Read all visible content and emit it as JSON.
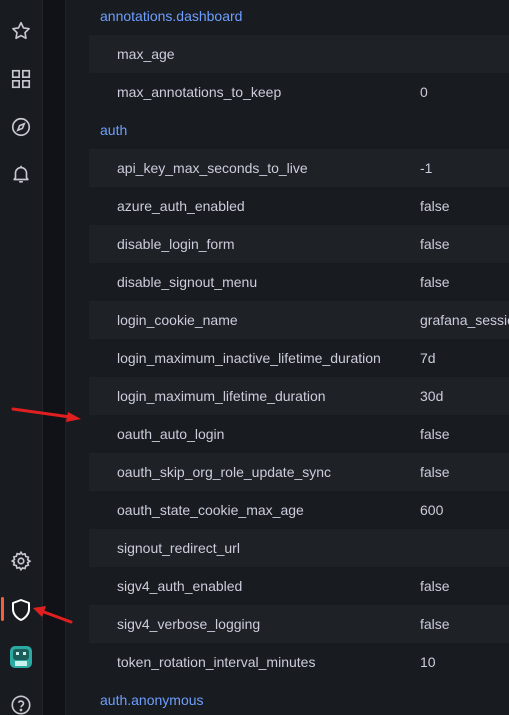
{
  "sidebar": {
    "icons": [
      {
        "name": "star-icon"
      },
      {
        "name": "dashboards-icon"
      },
      {
        "name": "explore-icon"
      },
      {
        "name": "alerting-icon"
      },
      {
        "name": "settings-gear-icon"
      },
      {
        "name": "server-admin-shield-icon",
        "active": true
      },
      {
        "name": "user-avatar"
      },
      {
        "name": "help-icon"
      }
    ],
    "accent_color": "#f55f3e"
  },
  "settings": {
    "sections": [
      {
        "title": "annotations.dashboard",
        "rows": [
          {
            "key": "max_age",
            "value": ""
          },
          {
            "key": "max_annotations_to_keep",
            "value": "0"
          }
        ]
      },
      {
        "title": "auth",
        "rows": [
          {
            "key": "api_key_max_seconds_to_live",
            "value": "-1"
          },
          {
            "key": "azure_auth_enabled",
            "value": "false"
          },
          {
            "key": "disable_login_form",
            "value": "false"
          },
          {
            "key": "disable_signout_menu",
            "value": "false"
          },
          {
            "key": "login_cookie_name",
            "value": "grafana_session"
          },
          {
            "key": "login_maximum_inactive_lifetime_duration",
            "value": "7d"
          },
          {
            "key": "login_maximum_lifetime_duration",
            "value": "30d"
          },
          {
            "key": "oauth_auto_login",
            "value": "false"
          },
          {
            "key": "oauth_skip_org_role_update_sync",
            "value": "false"
          },
          {
            "key": "oauth_state_cookie_max_age",
            "value": "600"
          },
          {
            "key": "signout_redirect_url",
            "value": ""
          },
          {
            "key": "sigv4_auth_enabled",
            "value": "false"
          },
          {
            "key": "sigv4_verbose_logging",
            "value": "false"
          },
          {
            "key": "token_rotation_interval_minutes",
            "value": "10"
          }
        ]
      },
      {
        "title": "auth.anonymous",
        "rows": []
      }
    ]
  },
  "colors": {
    "section_title": "#6e9fff",
    "annotation_arrow": "#e02020"
  }
}
